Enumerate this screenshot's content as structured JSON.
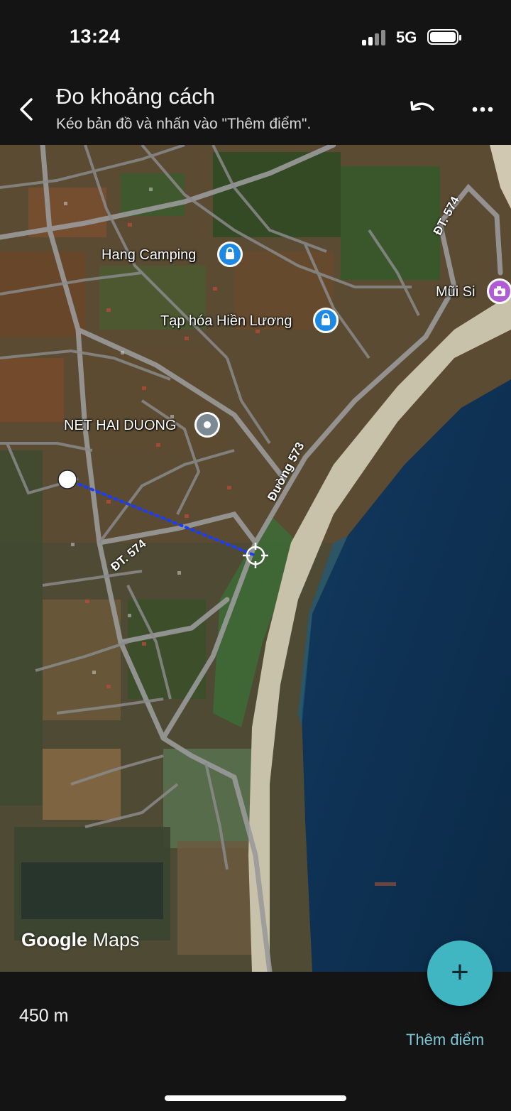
{
  "status_bar": {
    "time": "13:24",
    "network": "5G"
  },
  "app_bar": {
    "title": "Đo khoảng cách",
    "subtitle": "Kéo bản đồ và nhấn vào \"Thêm điểm\"."
  },
  "map": {
    "places": [
      {
        "name": "Hang Camping",
        "type": "shopping-bag-icon"
      },
      {
        "name": "Tạp hóa Hiền Lương",
        "type": "shopping-bag-icon"
      },
      {
        "name": "Mũi Si",
        "type": "camera-icon"
      },
      {
        "name": "NET HAI DUONG",
        "type": "place-pin-icon"
      }
    ],
    "roads": [
      "ĐT. 574",
      "Đường 573",
      "ĐT. 574"
    ],
    "attribution": {
      "brand": "Google",
      "product": "Maps"
    }
  },
  "measurement": {
    "distance": "450 m",
    "add_point_label": "Thêm điểm",
    "fab_label": "+"
  },
  "colors": {
    "accent": "#3fb6c2",
    "link": "#7cc6d6",
    "line": "#1a3cff",
    "bag_pin": "#1e88e5",
    "camera_pin": "#b05cd6"
  }
}
